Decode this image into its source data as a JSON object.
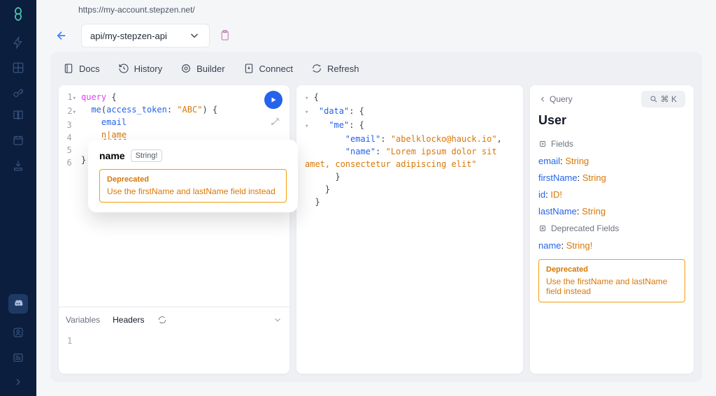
{
  "url": "https://my-account.stepzen.net/",
  "endpoint": "api/my-stepzen-api",
  "toolbar": {
    "docs": "Docs",
    "history": "History",
    "builder": "Builder",
    "connect": "Connect",
    "refresh": "Refresh"
  },
  "query_editor": {
    "lines": [
      "1",
      "2",
      "3",
      "4",
      "5",
      "6"
    ],
    "tokens": {
      "kw_query": "query",
      "fn_me": "me",
      "arg_name": "access_token",
      "arg_colon": ":",
      "arg_val": "\"ABC\"",
      "f_email": "email",
      "f_name_pre": "n",
      "f_name_post": "ame"
    }
  },
  "autocomplete": {
    "name": "name",
    "type": "String!",
    "dep_title": "Deprecated",
    "dep_reason": "Use the firstName and lastName field instead"
  },
  "result_json": {
    "data_key": "\"data\"",
    "me_key": "\"me\"",
    "email_key": "\"email\"",
    "email_val": "\"abelklocko@hauck.io\"",
    "name_key": "\"name\"",
    "name_val": "\"Lorem ipsum dolor sit amet, consectetur adipiscing elit\""
  },
  "var_tabs": {
    "variables": "Variables",
    "headers": "Headers"
  },
  "var_gutter": "1",
  "doc": {
    "breadcrumb": "Query",
    "title": "User",
    "fields_label": "Fields",
    "dep_fields_label": "Deprecated Fields",
    "shortcut_text": "⌘ K",
    "fields": [
      {
        "name": "email",
        "type": "String"
      },
      {
        "name": "firstName",
        "type": "String"
      },
      {
        "name": "id",
        "type": "ID!"
      },
      {
        "name": "lastName",
        "type": "String"
      }
    ],
    "dep_fields": [
      {
        "name": "name",
        "type": "String!"
      }
    ],
    "dep_title": "Deprecated",
    "dep_reason": "Use the firstName and lastName field instead"
  }
}
